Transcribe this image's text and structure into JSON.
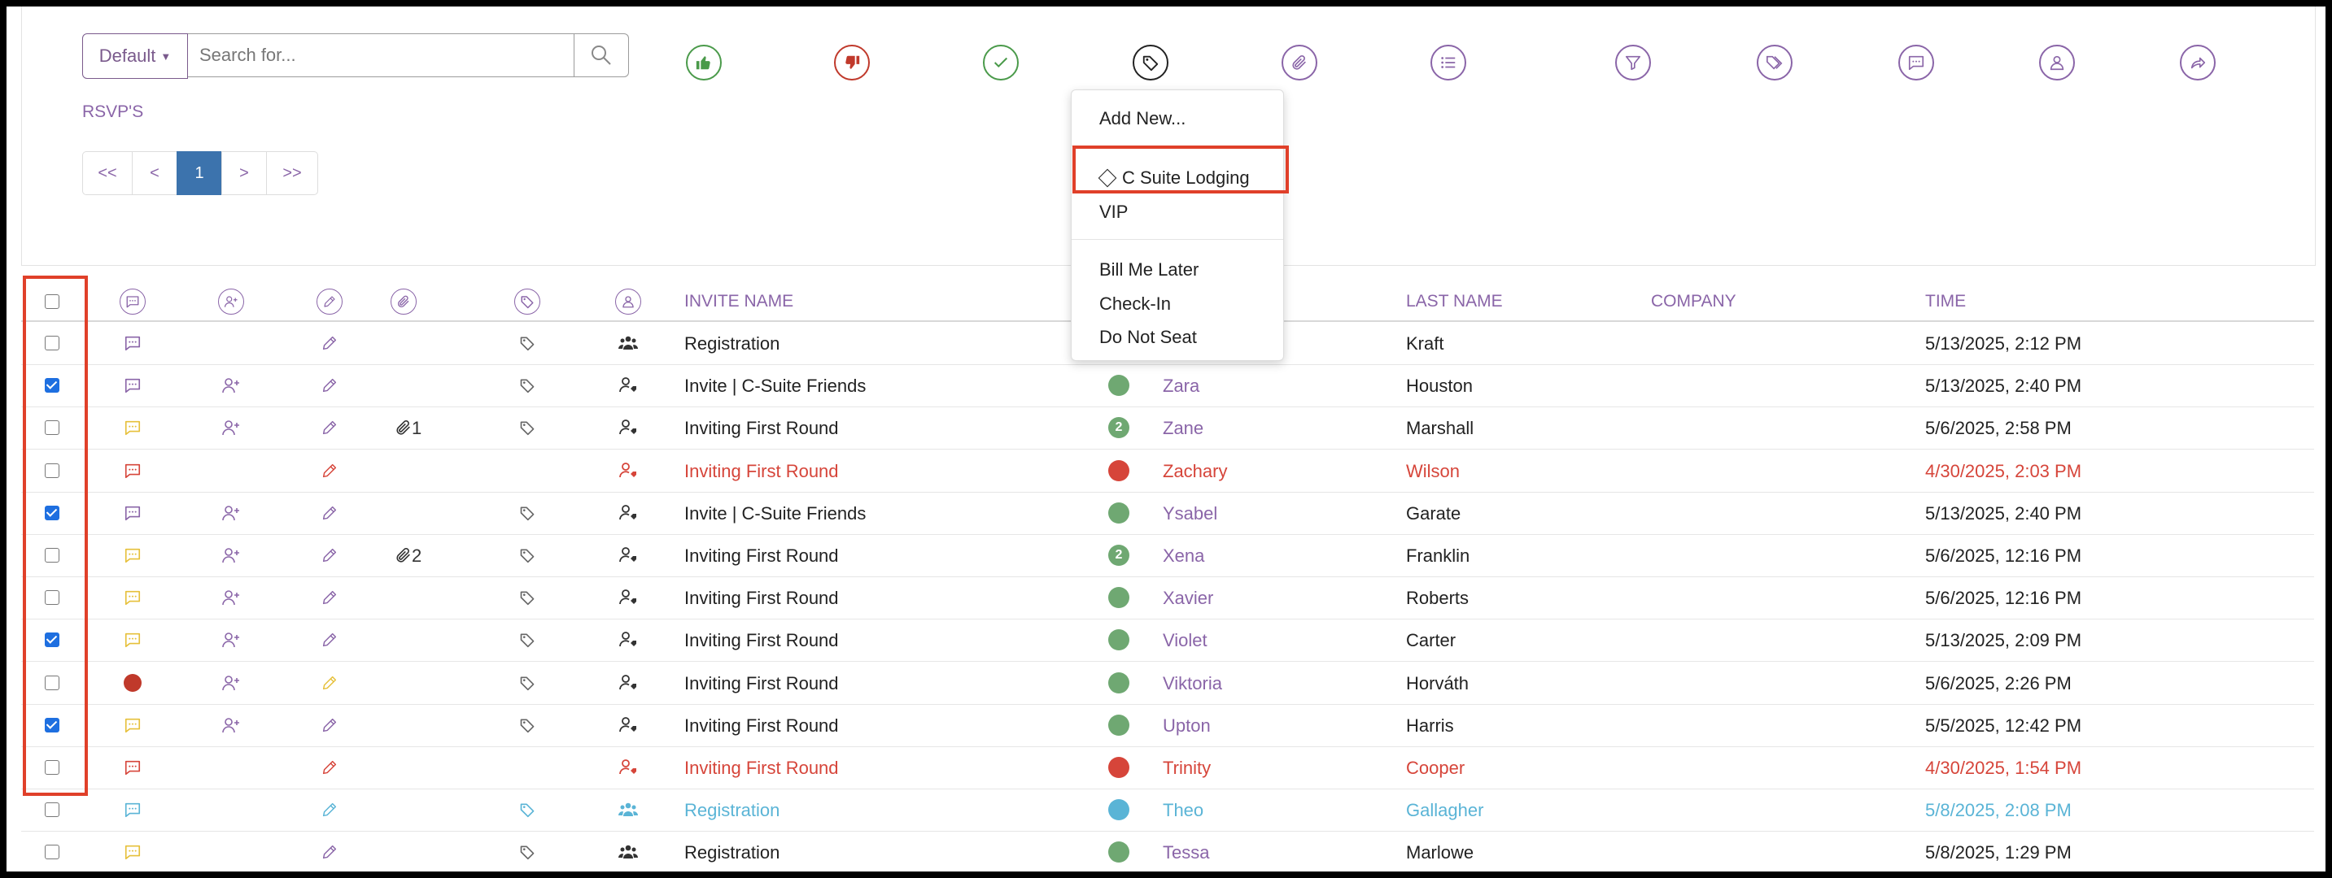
{
  "toolbar": {
    "default_label": "Default",
    "search_placeholder": "Search for...",
    "icons": [
      {
        "name": "thumbs-up-icon",
        "color": "#4a9a4a"
      },
      {
        "name": "thumbs-down-icon",
        "color": "#c0392b"
      },
      {
        "name": "check-icon",
        "color": "#4a9a4a"
      },
      {
        "name": "tag-icon",
        "color": "#222222"
      },
      {
        "name": "paperclip-icon",
        "color": "#8a65a8"
      },
      {
        "name": "list-icon",
        "color": "#8a65a8"
      },
      {
        "name": "filter-icon",
        "color": "#8a65a8"
      },
      {
        "name": "tags-icon",
        "color": "#8a65a8"
      },
      {
        "name": "comment-icon",
        "color": "#8a65a8"
      },
      {
        "name": "user-icon",
        "color": "#8a65a8"
      },
      {
        "name": "share-icon",
        "color": "#8a65a8"
      }
    ]
  },
  "section_label": "RSVP'S",
  "pager": {
    "first": "<<",
    "prev": "<",
    "current": "1",
    "next": ">",
    "last": ">>"
  },
  "tag_menu": {
    "add_new": "Add New...",
    "items_group1": [
      "C Suite Lodging",
      "VIP"
    ],
    "items_group2": [
      "Bill Me Later",
      "Check-In",
      "Do Not Seat"
    ]
  },
  "table": {
    "headers": {
      "invite_name": "INVITE NAME",
      "last_name": "LAST NAME",
      "company": "COMPANY",
      "time": "TIME"
    },
    "rows": [
      {
        "checked": false,
        "comment": "#8a65a8",
        "add_user": false,
        "pencil": "#8a65a8",
        "clip": "",
        "tag": true,
        "person": "group",
        "person_color": "#333",
        "invite": "Registration",
        "invite_color": "#222",
        "status": "",
        "first": "",
        "last": "Kraft",
        "time": "5/13/2025, 2:12 PM",
        "color": "#222"
      },
      {
        "checked": true,
        "comment": "#8a65a8",
        "add_user": true,
        "pencil": "#8a65a8",
        "clip": "",
        "tag": true,
        "person": "user",
        "person_color": "#333",
        "invite": "Invite | C-Suite Friends",
        "invite_color": "#222",
        "status": "green",
        "first": "Zara",
        "last": "Houston",
        "time": "5/13/2025, 2:40 PM",
        "color": "#222"
      },
      {
        "checked": false,
        "comment": "#e6c03a",
        "add_user": true,
        "pencil": "#8a65a8",
        "clip": "1",
        "tag": true,
        "person": "user",
        "person_color": "#333",
        "invite": "Inviting First Round",
        "invite_color": "#222",
        "status": "green2",
        "first": "Zane",
        "last": "Marshall",
        "time": "5/6/2025, 2:58 PM",
        "color": "#222"
      },
      {
        "checked": false,
        "comment": "#d6453a",
        "add_user": false,
        "pencil": "#d6453a",
        "clip": "",
        "tag": false,
        "person": "user",
        "person_color": "#d6453a",
        "invite": "Inviting First Round",
        "invite_color": "#d6453a",
        "status": "red",
        "first": "Zachary",
        "last": "Wilson",
        "time": "4/30/2025, 2:03 PM",
        "color": "#d6453a"
      },
      {
        "checked": true,
        "comment": "#8a65a8",
        "add_user": true,
        "pencil": "#8a65a8",
        "clip": "",
        "tag": true,
        "person": "user",
        "person_color": "#333",
        "invite": "Invite | C-Suite Friends",
        "invite_color": "#222",
        "status": "green",
        "first": "Ysabel",
        "last": "Garate",
        "time": "5/13/2025, 2:40 PM",
        "color": "#222"
      },
      {
        "checked": false,
        "comment": "#e6c03a",
        "add_user": true,
        "pencil": "#8a65a8",
        "clip": "2",
        "tag": true,
        "person": "user",
        "person_color": "#333",
        "invite": "Inviting First Round",
        "invite_color": "#222",
        "status": "green2",
        "first": "Xena",
        "last": "Franklin",
        "time": "5/6/2025, 12:16 PM",
        "color": "#222"
      },
      {
        "checked": false,
        "comment": "#e6c03a",
        "add_user": true,
        "pencil": "#8a65a8",
        "clip": "",
        "tag": true,
        "person": "user",
        "person_color": "#333",
        "invite": "Inviting First Round",
        "invite_color": "#222",
        "status": "green",
        "first": "Xavier",
        "last": "Roberts",
        "time": "5/6/2025, 12:16 PM",
        "color": "#222"
      },
      {
        "checked": true,
        "comment": "#e6c03a",
        "add_user": true,
        "pencil": "#8a65a8",
        "clip": "",
        "tag": true,
        "person": "user",
        "person_color": "#333",
        "invite": "Inviting First Round",
        "invite_color": "#222",
        "status": "green",
        "first": "Violet",
        "last": "Carter",
        "time": "5/13/2025, 2:09 PM",
        "color": "#222"
      },
      {
        "checked": false,
        "comment": "reddot",
        "add_user": true,
        "pencil": "#e6c03a",
        "clip": "",
        "tag": true,
        "person": "user",
        "person_color": "#333",
        "invite": "Inviting First Round",
        "invite_color": "#222",
        "status": "green",
        "first": "Viktoria",
        "last": "Horváth",
        "time": "5/6/2025, 2:26 PM",
        "color": "#222"
      },
      {
        "checked": true,
        "comment": "#e6c03a",
        "add_user": true,
        "pencil": "#8a65a8",
        "clip": "",
        "tag": true,
        "person": "user",
        "person_color": "#333",
        "invite": "Inviting First Round",
        "invite_color": "#222",
        "status": "green",
        "first": "Upton",
        "last": "Harris",
        "time": "5/5/2025, 12:42 PM",
        "color": "#222"
      },
      {
        "checked": false,
        "comment": "#d6453a",
        "add_user": false,
        "pencil": "#d6453a",
        "clip": "",
        "tag": false,
        "person": "user",
        "person_color": "#d6453a",
        "invite": "Inviting First Round",
        "invite_color": "#d6453a",
        "status": "red",
        "first": "Trinity",
        "last": "Cooper",
        "time": "4/30/2025, 1:54 PM",
        "color": "#d6453a"
      },
      {
        "checked": false,
        "comment": "#5ab4d6",
        "add_user": false,
        "pencil": "#5ab4d6",
        "clip": "",
        "tag": true,
        "tag_color": "#5ab4d6",
        "person": "group",
        "person_color": "#5ab4d6",
        "invite": "Registration",
        "invite_color": "#5ab4d6",
        "status": "blue",
        "first": "Theo",
        "last": "Gallagher",
        "time": "5/8/2025, 2:08 PM",
        "color": "#5ab4d6"
      },
      {
        "checked": false,
        "comment": "#e6c03a",
        "add_user": false,
        "pencil": "#8a65a8",
        "clip": "",
        "tag": true,
        "person": "group",
        "person_color": "#333",
        "invite": "Registration",
        "invite_color": "#222",
        "status": "green",
        "first": "Tessa",
        "last": "Marlowe",
        "time": "5/8/2025, 1:29 PM",
        "color": "#222"
      }
    ]
  },
  "status_colors": {
    "green": "#6fa872",
    "red": "#d6453a",
    "blue": "#5ab4d6"
  },
  "name_color": "#8a65a8"
}
